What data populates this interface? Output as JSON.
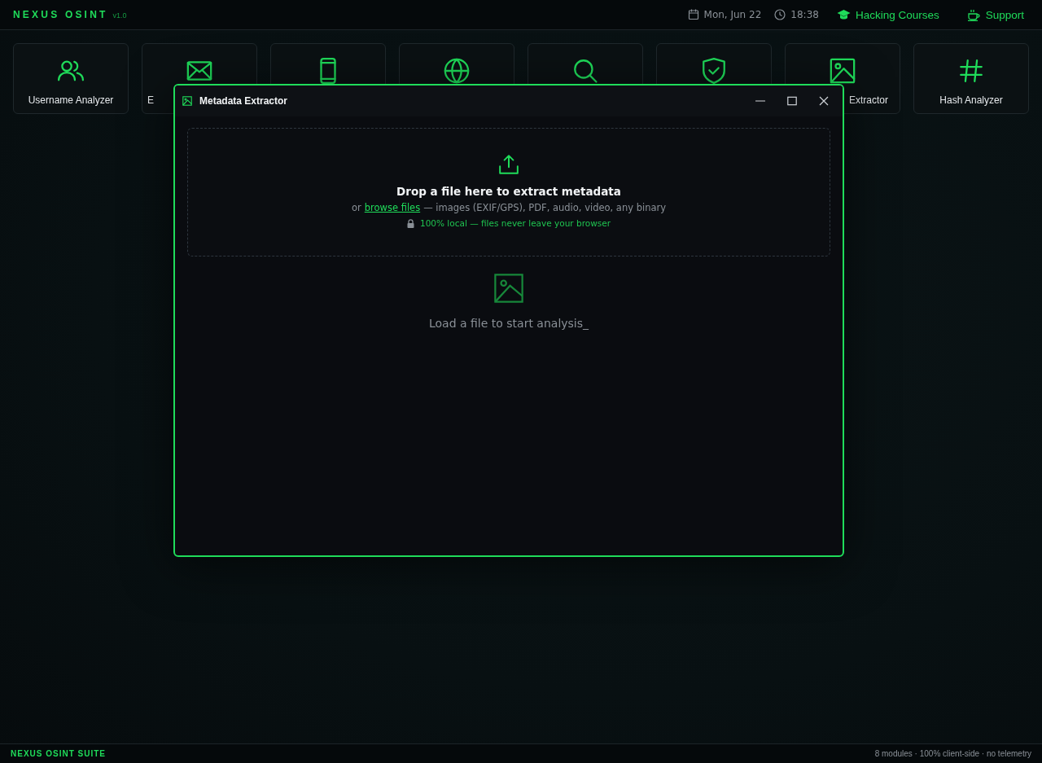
{
  "header": {
    "brand": "NEXUS OSINT",
    "version": "v1.0",
    "date": "Mon, Jun 22",
    "time": "18:38",
    "links": [
      "Hacking Courses",
      "Support"
    ]
  },
  "modules": [
    {
      "kind": "tool",
      "label": "Username Analyzer"
    },
    {
      "kind": "tool",
      "label": "E"
    },
    {
      "kind": "tool"
    },
    {
      "kind": "tool"
    },
    {
      "kind": "tool"
    },
    {
      "kind": "tool"
    },
    {
      "kind": "tool",
      "label": "Extractor"
    },
    {
      "kind": "tool",
      "label": "Hash Analyzer"
    }
  ],
  "window": {
    "title": "Metadata Extractor",
    "drop_title": "Drop a file here to extract metadata",
    "drop_prefix": "or",
    "browse_link": "browse files",
    "drop_suffix": "— images (EXIF/GPS), PDF, audio, video, any binary",
    "privacy_note": "100% local — files never leave your browser",
    "empty_message": "Load a file to start analysis_"
  },
  "footer": {
    "left": "NEXUS OSINT SUITE",
    "right": "8 modules · 100% client-side · no telemetry"
  }
}
